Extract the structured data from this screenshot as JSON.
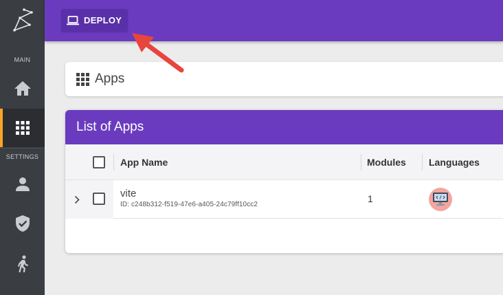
{
  "sidebar": {
    "sections": {
      "main_label": "MAIN",
      "settings_label": "SETTINGS"
    },
    "items": [
      {
        "icon": "home-icon",
        "active": false
      },
      {
        "icon": "apps-grid-icon",
        "active": true
      },
      {
        "icon": "user-icon",
        "active": false
      },
      {
        "icon": "shield-check-icon",
        "active": false
      },
      {
        "icon": "running-person-icon",
        "active": false
      }
    ],
    "accent_color": "#f5a623"
  },
  "topbar": {
    "deploy_label": "DEPLOY",
    "deploy_icon": "laptop-icon",
    "color": "#6a3bbf"
  },
  "breadcrumb": {
    "title": "Apps",
    "icon": "apps-grid-icon"
  },
  "panel": {
    "title": "List of Apps",
    "columns": [
      "App Name",
      "Modules",
      "Languages"
    ],
    "rows": [
      {
        "name": "vite",
        "id": "ID: c248b312-f519-47e6-a405-24c79ff10cc2",
        "modules": "1",
        "language_icon": "computer-code-icon"
      }
    ]
  }
}
